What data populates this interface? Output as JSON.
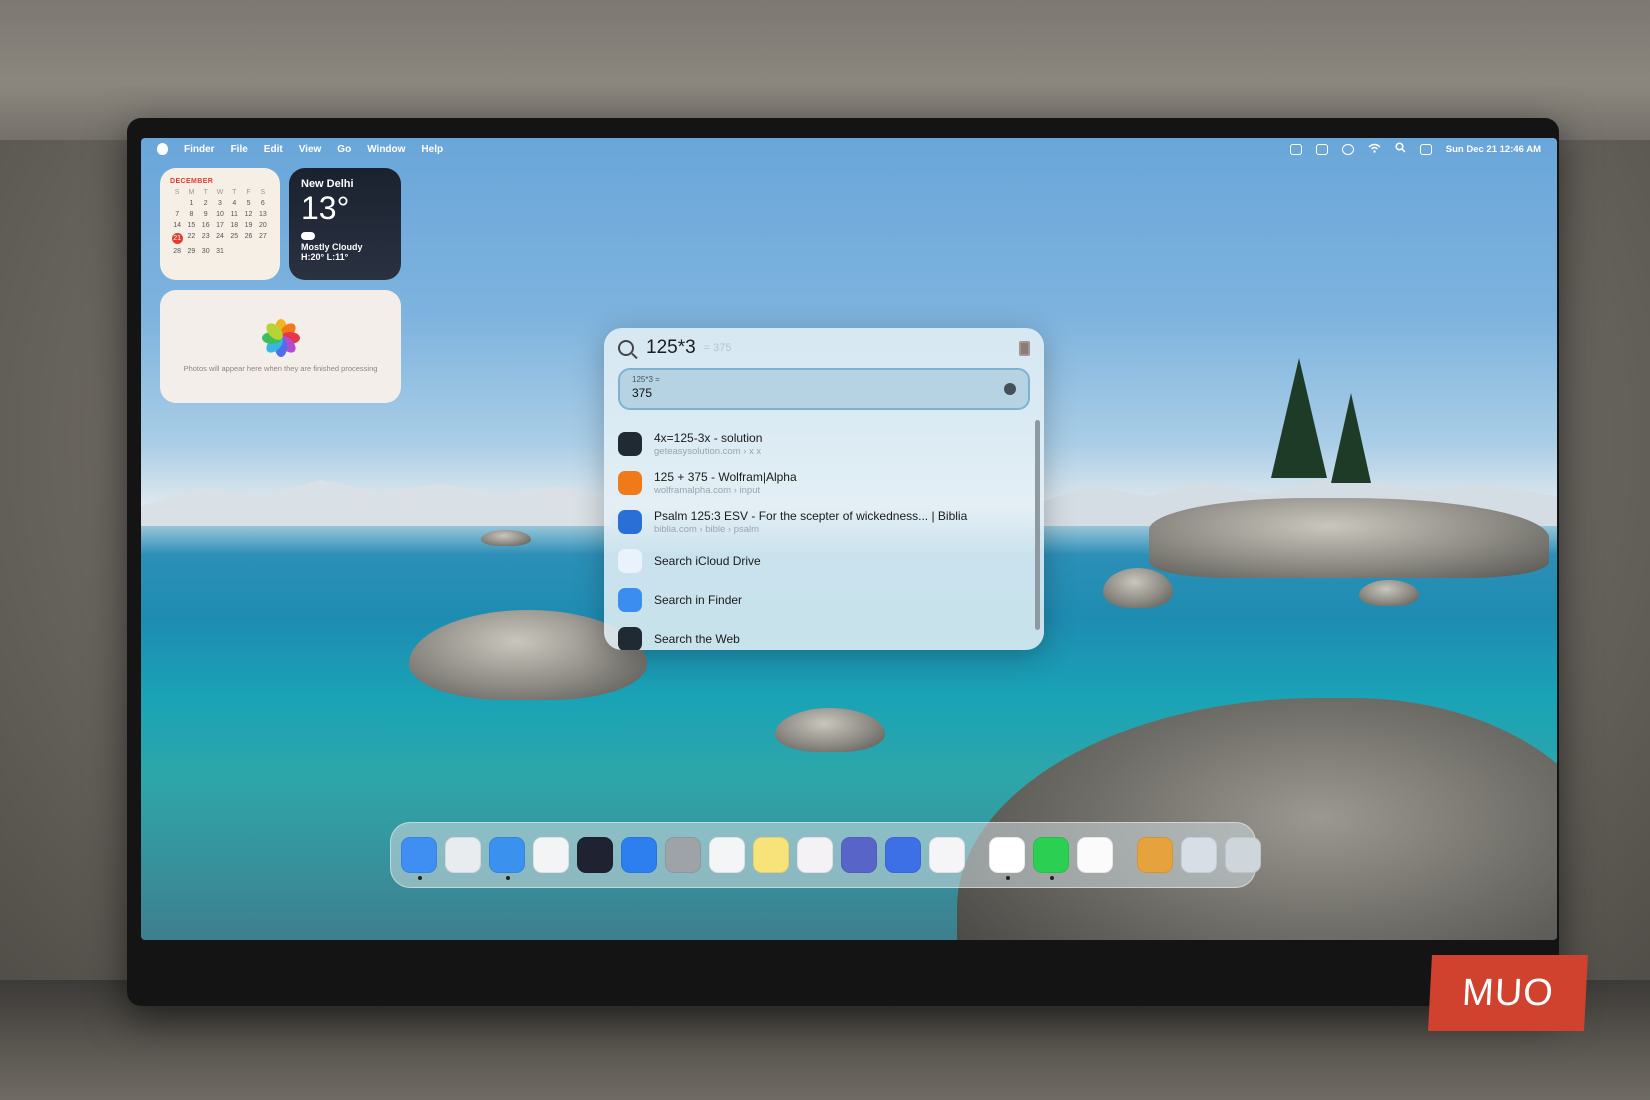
{
  "menubar": {
    "app": "Finder",
    "menus": [
      "File",
      "Edit",
      "View",
      "Go",
      "Window",
      "Help"
    ],
    "datetime": "Sun Dec 21  12:46 AM",
    "status_icons": [
      "notion-icon",
      "screen-mirroring-icon",
      "account-icon",
      "wifi-icon",
      "spotlight-search-icon",
      "control-center-icon"
    ]
  },
  "calendar_widget": {
    "month": "DECEMBER",
    "weekdays": [
      "S",
      "M",
      "T",
      "W",
      "T",
      "F",
      "S"
    ],
    "weeks": [
      [
        "",
        "1",
        "2",
        "3",
        "4",
        "5",
        "6"
      ],
      [
        "7",
        "8",
        "9",
        "10",
        "11",
        "12",
        "13"
      ],
      [
        "14",
        "15",
        "16",
        "17",
        "18",
        "19",
        "20"
      ],
      [
        "21",
        "22",
        "23",
        "24",
        "25",
        "26",
        "27"
      ],
      [
        "28",
        "29",
        "30",
        "31",
        "",
        "",
        ""
      ]
    ],
    "today": "21"
  },
  "weather_widget": {
    "city": "New Delhi",
    "temp": "13°",
    "condition": "Mostly Cloudy",
    "high_low": "H:20° L:11°"
  },
  "photos_widget": {
    "message": "Photos will appear here when they are finished processing"
  },
  "spotlight": {
    "query": "125*3",
    "inline_hint": "= 375",
    "result": {
      "expression": "125*3 =",
      "value": "375"
    },
    "items": [
      {
        "title": "4x=125-3x - solution",
        "subtitle": "geteasysolution.com › x x",
        "icon": "chatgpt-icon",
        "color": "#1f2a33"
      },
      {
        "title": "125 + 375 - Wolfram|Alpha",
        "subtitle": "wolframalpha.com › input",
        "icon": "wolframalpha-icon",
        "color": "#f07a1a"
      },
      {
        "title": "Psalm 125:3 ESV - For the scepter of wickedness... | Biblia",
        "subtitle": "biblia.com › bible › psalm",
        "icon": "biblia-icon",
        "color": "#2a6fd6"
      },
      {
        "title": "Search iCloud Drive",
        "subtitle": "",
        "icon": "icloud-icon",
        "color": "#e9f3fb"
      },
      {
        "title": "Search in Finder",
        "subtitle": "",
        "icon": "finder-icon",
        "color": "#3b8df0"
      },
      {
        "title": "Search the Web",
        "subtitle": "",
        "icon": "chatgpt-icon",
        "color": "#1f2a33"
      }
    ]
  },
  "dock": {
    "apps": [
      {
        "name": "finder-icon",
        "color": "#3f8ef2",
        "running": true
      },
      {
        "name": "launchpad-icon",
        "color": "#e9ecef",
        "running": false
      },
      {
        "name": "safari-icon",
        "color": "#3a92ee",
        "running": true
      },
      {
        "name": "chrome-icon",
        "color": "#f3f4f6",
        "running": false
      },
      {
        "name": "telegram-icon",
        "color": "#1f2230",
        "running": false
      },
      {
        "name": "app-store-icon",
        "color": "#2d7ff0",
        "running": false
      },
      {
        "name": "system-settings-icon",
        "color": "#9ea3a8",
        "running": false
      },
      {
        "name": "reminders-icon",
        "color": "#f4f5f6",
        "running": false
      },
      {
        "name": "notes-icon",
        "color": "#f8e27a",
        "running": false
      },
      {
        "name": "slack-icon",
        "color": "#f5f2f6",
        "running": false
      },
      {
        "name": "simulator-icon",
        "color": "#5864c8",
        "running": false
      },
      {
        "name": "shortcuts-icon",
        "color": "#3d6fe6",
        "running": false
      },
      {
        "name": "asana-icon",
        "color": "#f5f4f6",
        "running": false
      },
      {
        "name": "notion-icon",
        "color": "#ffffff",
        "running": true
      },
      {
        "name": "whatsapp-icon",
        "color": "#2bcf52",
        "running": true
      },
      {
        "name": "photos-icon",
        "color": "#fbfbfb",
        "running": false
      }
    ],
    "stacks": [
      {
        "name": "downloads-stack-icon",
        "color": "#e6a23c"
      },
      {
        "name": "screenshots-stack-icon",
        "color": "#d7dee6"
      },
      {
        "name": "trash-icon",
        "color": "#cfd6db"
      }
    ]
  },
  "watermark": "MUO"
}
